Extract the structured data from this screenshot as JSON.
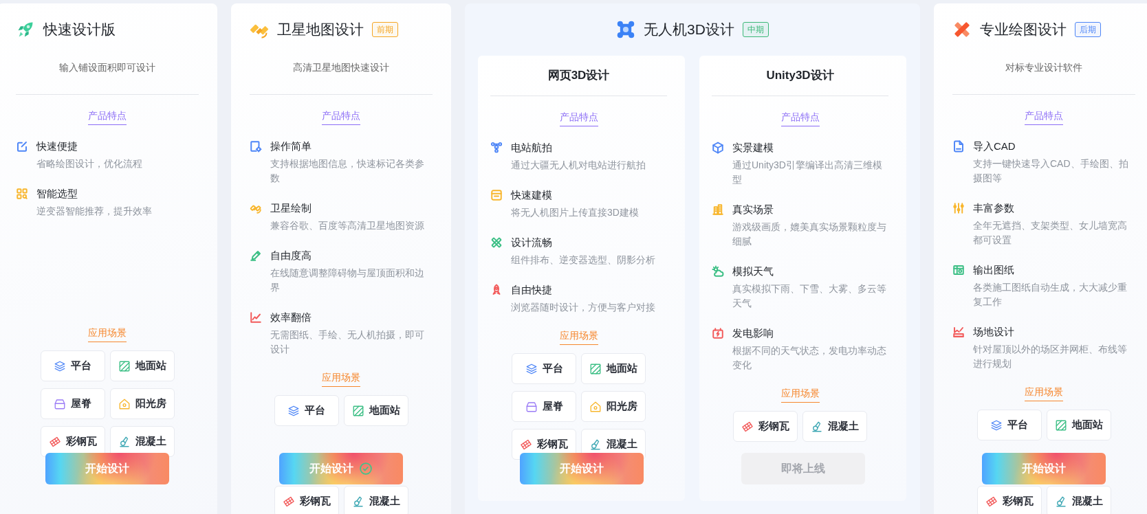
{
  "cards": [
    {
      "kind": "single",
      "title": "快速设计版",
      "subtitle": "输入铺设面积即可设计",
      "features_label": "产品特点",
      "features": [
        {
          "kind": "edit",
          "color": "#4e86f7",
          "title": "快速便捷",
          "desc": "省略绘图设计，优化流程"
        },
        {
          "kind": "grid",
          "color": "#f8b62d",
          "title": "智能选型",
          "desc": "逆变器智能推荐，提升效率"
        }
      ],
      "scenes_label": "应用场景",
      "scenes": [
        {
          "kind": "layers",
          "label": "平台"
        },
        {
          "kind": "hatch",
          "label": "地面站"
        },
        {
          "kind": "roof",
          "label": "屋脊"
        },
        {
          "kind": "house",
          "label": "阳光房"
        },
        {
          "kind": "tiles",
          "label": "彩钢瓦"
        },
        {
          "kind": "mixer",
          "label": "混凝土"
        }
      ],
      "button": {
        "label": "开始设计",
        "disabled": false,
        "checked": false
      }
    },
    {
      "kind": "single",
      "title": "卫星地图设计",
      "tag": {
        "text": "前期",
        "color": "#f5a623"
      },
      "subtitle": "高清卫星地图快速设计",
      "features_label": "产品特点",
      "features": [
        {
          "kind": "settings",
          "color": "#4e86f7",
          "title": "操作简单",
          "desc": "支持根据地图信息，快速标记各类参数"
        },
        {
          "kind": "satellite",
          "color": "#f8b62d",
          "title": "卫星绘制",
          "desc": "兼容谷歌、百度等高清卫星地图资源"
        },
        {
          "kind": "pen",
          "color": "#3cbf85",
          "title": "自由度高",
          "desc": "在线随意调整障碍物与屋顶面积和边界"
        },
        {
          "kind": "chart",
          "color": "#f25a5a",
          "title": "效率翻倍",
          "desc": "无需图纸、手绘、无人机拍摄，即可设计"
        }
      ],
      "scenes_label": "应用场景",
      "scenes": [
        {
          "kind": "layers",
          "label": "平台"
        },
        {
          "kind": "hatch",
          "label": "地面站"
        },
        {
          "kind": "covered"
        },
        {
          "kind": "covered"
        },
        {
          "kind": "tiles",
          "label": "彩钢瓦"
        },
        {
          "kind": "mixer",
          "label": "混凝土"
        }
      ],
      "button": {
        "label": "开始设计",
        "disabled": false,
        "checked": true
      }
    },
    {
      "kind": "group",
      "title": "无人机3D设计",
      "tag": {
        "text": "中期",
        "color": "#3cb878"
      },
      "panels": [
        {
          "title": "网页3D设计",
          "features_label": "产品特点",
          "features": [
            {
              "kind": "drone",
              "color": "#4e86f7",
              "title": "电站航拍",
              "desc": "通过大疆无人机对电站进行航拍"
            },
            {
              "kind": "box",
              "color": "#f8b62d",
              "title": "快速建模",
              "desc": "将无人机图片上传直接3D建模"
            },
            {
              "kind": "tools",
              "color": "#3cbf85",
              "title": "设计流畅",
              "desc": "组件排布、逆变器选型、阴影分析"
            },
            {
              "kind": "rocket",
              "color": "#f25a5a",
              "title": "自由快捷",
              "desc": "浏览器随时设计，方便与客户对接"
            }
          ],
          "scenes_label": "应用场景",
          "scenes": [
            {
              "kind": "layers",
              "label": "平台"
            },
            {
              "kind": "hatch",
              "label": "地面站"
            },
            {
              "kind": "roof",
              "label": "屋脊"
            },
            {
              "kind": "house",
              "label": "阳光房"
            },
            {
              "kind": "tiles",
              "label": "彩钢瓦"
            },
            {
              "kind": "mixer",
              "label": "混凝土"
            }
          ],
          "button": {
            "label": "开始设计",
            "disabled": false,
            "checked": false
          }
        },
        {
          "title": "Unity3D设计",
          "features_label": "产品特点",
          "features": [
            {
              "kind": "cube",
              "color": "#4e86f7",
              "title": "实景建模",
              "desc": "通过Unity3D引擎编译出高清三维模型"
            },
            {
              "kind": "building",
              "color": "#f8b62d",
              "title": "真实场景",
              "desc": "游戏级画质，媲美真实场景颗粒度与细腻"
            },
            {
              "kind": "weather",
              "color": "#3cbf85",
              "title": "模拟天气",
              "desc": "真实模拟下雨、下雪、大雾、多云等天气"
            },
            {
              "kind": "battery",
              "color": "#f25a5a",
              "title": "发电影响",
              "desc": "根据不同的天气状态，发电功率动态变化"
            }
          ],
          "scenes_label": "应用场景",
          "scenes": [
            {
              "kind": "tiles",
              "label": "彩钢瓦"
            },
            {
              "kind": "mixer",
              "label": "混凝土"
            }
          ],
          "button": {
            "label": "即将上线",
            "disabled": true,
            "checked": false
          }
        }
      ]
    },
    {
      "kind": "single",
      "title": "专业绘图设计",
      "tag": {
        "text": "后期",
        "color": "#4e86f7"
      },
      "subtitle": "对标专业设计软件",
      "features_label": "产品特点",
      "features": [
        {
          "kind": "document",
          "color": "#4e86f7",
          "title": "导入CAD",
          "desc": "支持一键快速导入CAD、手绘图、拍摄图等"
        },
        {
          "kind": "sliders",
          "color": "#f8b62d",
          "title": "丰富参数",
          "desc": "全年无遮挡、支架类型、女儿墙宽高都可设置"
        },
        {
          "kind": "map",
          "color": "#3cbf85",
          "title": "输出图纸",
          "desc": "各类施工图纸自动生成，大大减少重复工作"
        },
        {
          "kind": "site",
          "color": "#f25a5a",
          "title": "场地设计",
          "desc": "针对屋顶以外的场区并网柜、布线等进行规划"
        }
      ],
      "scenes_label": "应用场景",
      "scenes": [
        {
          "kind": "layers",
          "label": "平台"
        },
        {
          "kind": "hatch",
          "label": "地面站"
        },
        {
          "kind": "covered"
        },
        {
          "kind": "covered"
        },
        {
          "kind": "tiles",
          "label": "彩钢瓦"
        },
        {
          "kind": "mixer",
          "label": "混凝土"
        }
      ],
      "button": {
        "label": "开始设计",
        "disabled": false,
        "checked": false
      }
    }
  ]
}
